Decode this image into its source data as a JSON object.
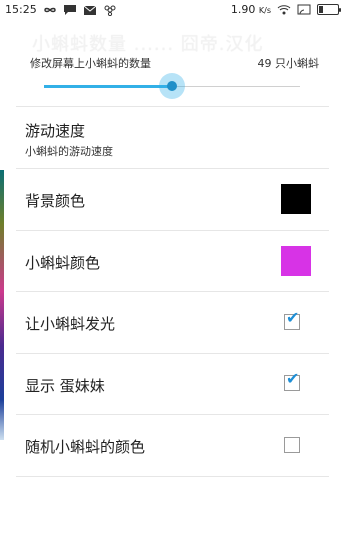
{
  "statusbar": {
    "time": "15:25",
    "left_icons": [
      "infinity-icon",
      "chat-icon",
      "mail-icon",
      "fan-icon"
    ],
    "speed": "1.90",
    "speed_unit": "K/s",
    "right_icons": [
      "wifi-icon",
      "cast-icon",
      "battery-icon"
    ]
  },
  "title": "小蝌蚪数量 ...... 囧帝.汉化",
  "slider": {
    "label": "修改屏幕上小蝌蚪的数量",
    "value_text": "49 只小蝌蚪",
    "progress": 0.5,
    "accent": "#32b0e7"
  },
  "settings": [
    {
      "id": "speed",
      "title": "游动速度",
      "subtitle": "小蝌蚪的游动速度",
      "type": "text"
    },
    {
      "id": "bgcolor",
      "title": "背景颜色",
      "type": "color",
      "color": "#000000"
    },
    {
      "id": "tadpolecolor",
      "title": "小蝌蚪颜色",
      "type": "color",
      "color": "#d733e6"
    },
    {
      "id": "glow",
      "title": "让小蝌蚪发光",
      "type": "checkbox",
      "checked": true
    },
    {
      "id": "sister",
      "title": "显示 蛋妹妹",
      "type": "checkbox",
      "checked": true
    },
    {
      "id": "random",
      "title": "随机小蝌蚪的颜色",
      "type": "checkbox",
      "checked": false
    }
  ],
  "check_glyph": "✔"
}
